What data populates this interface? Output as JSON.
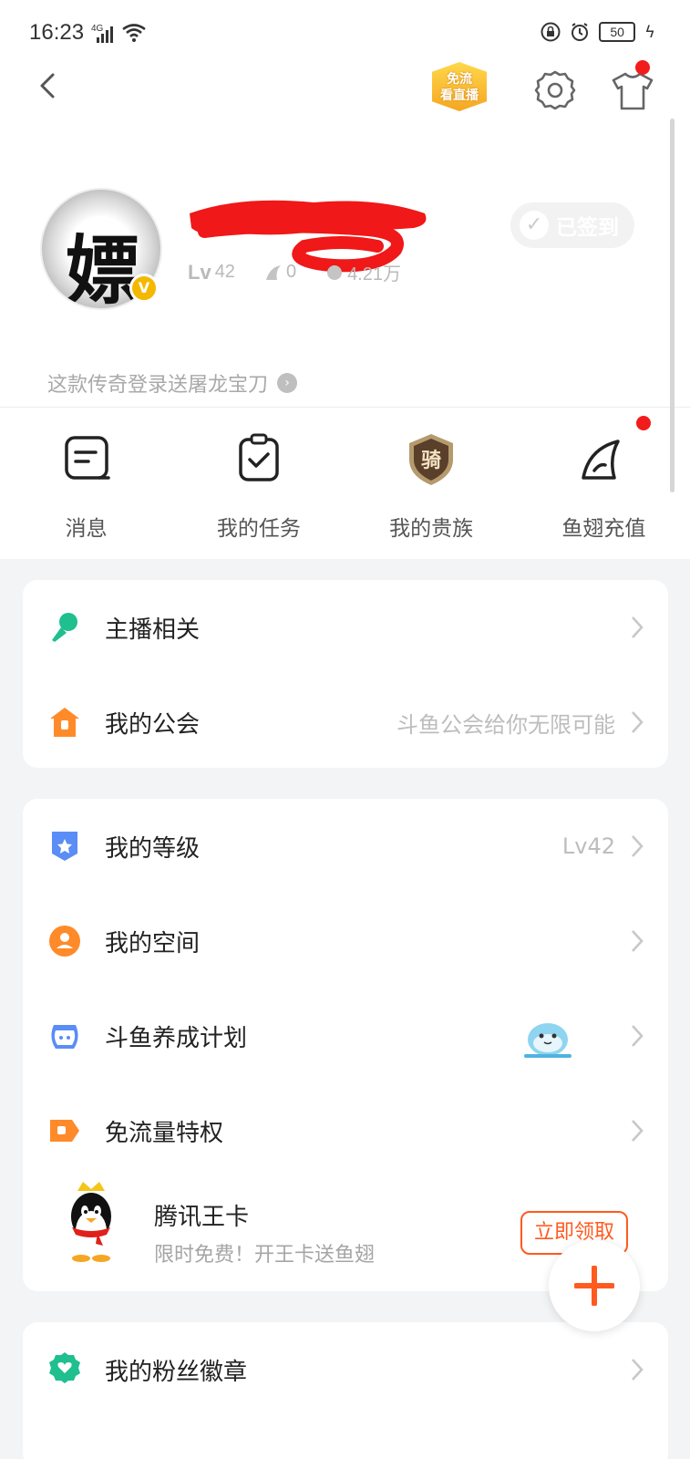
{
  "status_bar": {
    "time": "16:23",
    "network": "4G",
    "battery": "50"
  },
  "header": {
    "free_badge_line1": "免流",
    "free_badge_line2": "看直播",
    "sign_in_label": "已签到"
  },
  "profile": {
    "level_prefix": "Lv",
    "level_value": "42",
    "fish_fin_count": "0",
    "followers": "4.21万",
    "promo_text": "这款传奇登录送屠龙宝刀"
  },
  "quick_actions": [
    {
      "label": "消息",
      "icon": "message-icon"
    },
    {
      "label": "我的任务",
      "icon": "task-clipboard-icon"
    },
    {
      "label": "我的贵族",
      "icon": "noble-shield-icon"
    },
    {
      "label": "鱼翅充值",
      "icon": "fish-fin-icon"
    }
  ],
  "card1": [
    {
      "label": "主播相关",
      "sub": "",
      "icon": "microphone-icon"
    },
    {
      "label": "我的公会",
      "sub": "斗鱼公会给你无限可能",
      "icon": "guild-house-icon"
    }
  ],
  "card2": [
    {
      "label": "我的等级",
      "sub": "Lv42",
      "icon": "level-badge-icon"
    },
    {
      "label": "我的空间",
      "sub": "",
      "icon": "user-space-icon"
    },
    {
      "label": "斗鱼养成计划",
      "sub": "",
      "icon": "fishbowl-icon"
    },
    {
      "label": "免流量特权",
      "sub": "",
      "icon": "free-data-icon"
    }
  ],
  "tencent_card": {
    "title": "腾讯王卡",
    "subtitle": "限时免费！开王卡送鱼翅",
    "cta": "立即领取"
  },
  "card3": [
    {
      "label": "我的粉丝徽章",
      "sub": "",
      "icon": "fan-badge-icon"
    }
  ],
  "colors": {
    "accent": "#ff5a1f",
    "green": "#1fbf8f",
    "orange": "#ff8a2a",
    "blue": "#5a8df5",
    "red_dot": "#f21c1c"
  }
}
